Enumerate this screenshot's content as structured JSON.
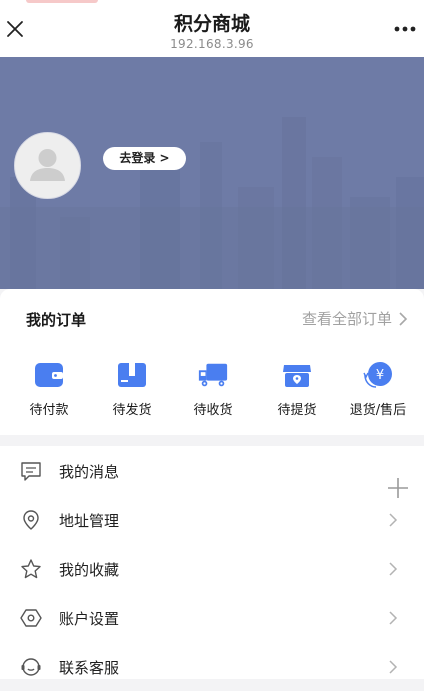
{
  "nav": {
    "title": "积分商城",
    "subtitle": "192.168.3.96",
    "close_icon": "close-icon",
    "more_icon": "more-dots-icon"
  },
  "profile": {
    "avatar_icon": "default-avatar-icon",
    "login_label": "去登录 >"
  },
  "orders": {
    "title": "我的订单",
    "view_all_label": "查看全部订单",
    "accent_color": "#4a7ef0",
    "items": [
      {
        "label": "待付款",
        "icon": "wallet-icon"
      },
      {
        "label": "待发货",
        "icon": "gift-box-icon"
      },
      {
        "label": "待收货",
        "icon": "truck-icon"
      },
      {
        "label": "待提货",
        "icon": "store-icon"
      },
      {
        "label": "退货/售后",
        "icon": "refund-icon"
      }
    ]
  },
  "menu": {
    "items": [
      {
        "label": "我的消息",
        "icon": "message-icon"
      },
      {
        "label": "地址管理",
        "icon": "location-pin-icon"
      },
      {
        "label": "我的收藏",
        "icon": "star-icon"
      },
      {
        "label": "账户设置",
        "icon": "settings-hexagon-icon"
      },
      {
        "label": "联系客服",
        "icon": "customer-service-icon"
      }
    ],
    "plus_icon": "plus-icon"
  }
}
